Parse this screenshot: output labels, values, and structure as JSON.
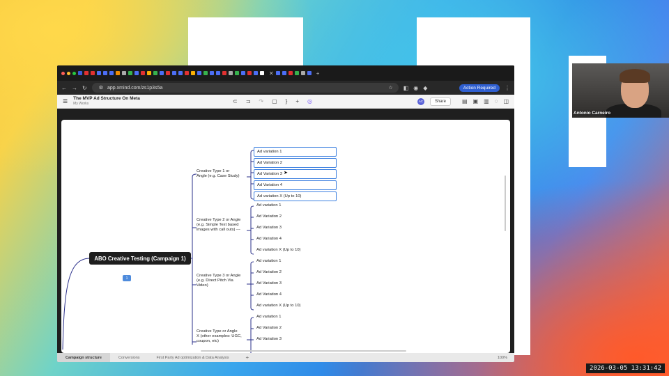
{
  "browser": {
    "url": "app.xmind.com/zs1p3s5a",
    "action_required": "Action Required"
  },
  "app": {
    "doc_title": "The MVP Ad Structure On Meta",
    "doc_location": "My Works",
    "avatar_initials": "AC",
    "share_label": "Share"
  },
  "mindmap": {
    "root": "ABO Creative Testing (Campaign 1)",
    "badge": "1",
    "branches": [
      {
        "label_lines": [
          "Creative Type 1 or",
          "Angle (e.g. Case Study)"
        ],
        "leaves": [
          "Ad variation 1",
          "Ad Variation 2",
          "Ad Variation 3",
          "Ad Variation 4",
          "Ad variation X (Up to 10)"
        ]
      },
      {
        "label_lines": [
          "Creative Type 2 or Angle",
          "(e.g. Simple Text based",
          "images with call outs) ---"
        ],
        "leaves": [
          "Ad variation 1",
          "Ad Variation 2",
          "Ad Variation 3",
          "Ad Variation 4",
          "Ad variation X (Up to 10)"
        ]
      },
      {
        "label_lines": [
          "Creative Type 3 or Angle",
          "(e.g. Direct Pitch Via",
          "Video)"
        ],
        "leaves": [
          "Ad variation 1",
          "Ad Variation 2",
          "Ad Variation 3",
          "Ad Variation 4",
          "Ad variation X (Up to 10)"
        ]
      },
      {
        "label_lines": [
          "Creative Type or Angle",
          "X (other examples: UGC,",
          "coupon, etc)"
        ],
        "leaves": [
          "Ad variation 1",
          "Ad Variation 2",
          "Ad Variation 3"
        ]
      }
    ]
  },
  "sheets": {
    "tabs": [
      "Campaign structure",
      "Conversions",
      "First Party Ad optimization & Data Analysis"
    ],
    "add": "+",
    "zoom": "100%"
  },
  "webcam": {
    "name": "Antonio Carneiro"
  },
  "timestamp": "2026-03-05  13:31:42"
}
